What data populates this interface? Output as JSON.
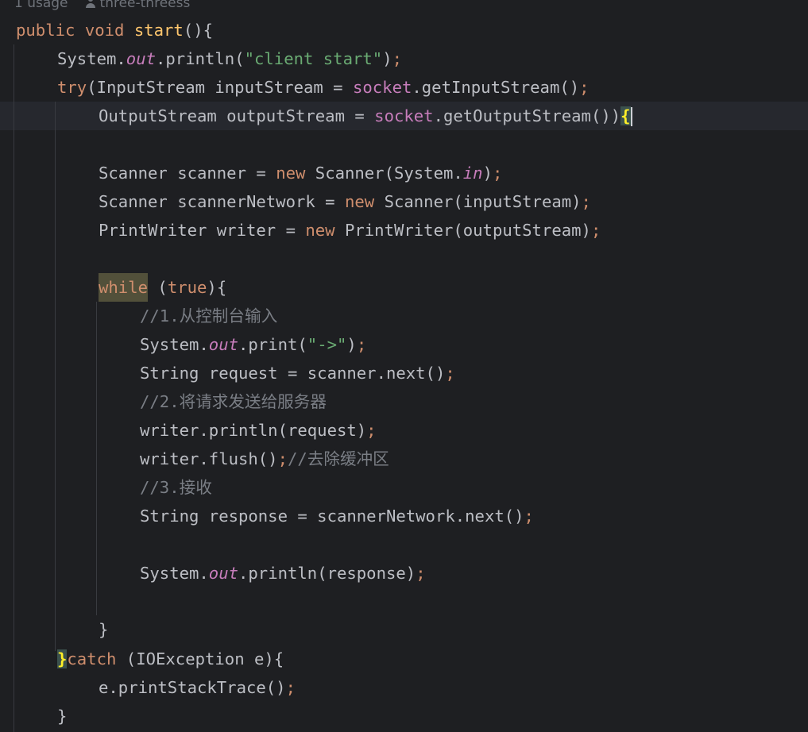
{
  "hint": {
    "usages": "1 usage",
    "author": "three-threess"
  },
  "code": {
    "l01_kw1": "public",
    "l01_kw2": "void",
    "l01_fn": "start",
    "l01_rest": "(){",
    "l02_a": "System.",
    "l02_out": "out",
    "l02_b": ".println(",
    "l02_str": "\"client start\"",
    "l02_c": ")",
    "l02_semi": ";",
    "l03_try": "try",
    "l03_a": "(InputStream inputStream = ",
    "l03_sock": "socket",
    "l03_b": ".getInputStream()",
    "l03_semi": ";",
    "l04_a": "OutputStream outputStream = ",
    "l04_sock": "socket",
    "l04_b": ".getOutputStream())",
    "l04_brace": "{",
    "l06_a": "Scanner scanner = ",
    "l06_new": "new",
    "l06_b": " Scanner(System.",
    "l06_in": "in",
    "l06_c": ")",
    "l06_semi": ";",
    "l07_a": "Scanner scannerNetwork = ",
    "l07_new": "new",
    "l07_b": " Scanner(inputStream)",
    "l07_semi": ";",
    "l08_a": "PrintWriter writer = ",
    "l08_new": "new",
    "l08_b": " PrintWriter(outputStream)",
    "l08_semi": ";",
    "l10_while": "while",
    "l10_a": " (",
    "l10_true": "true",
    "l10_b": "){",
    "l11_cmt": "//1.",
    "l11_cjk": "从控制台输入",
    "l12_a": "System.",
    "l12_out": "out",
    "l12_b": ".print(",
    "l12_str": "\"->\"",
    "l12_c": ")",
    "l12_semi": ";",
    "l13_a": "String request = scanner.next()",
    "l13_semi": ";",
    "l14_cmt": "//2.",
    "l14_cjk": "将请求发送给服务器",
    "l15_a": "writer.println(request)",
    "l15_semi": ";",
    "l16_a": "writer.flush()",
    "l16_semi": ";",
    "l16_cmt": "//",
    "l16_cjk": "去除缓冲区",
    "l17_cmt": "//3.",
    "l17_cjk": "接收",
    "l18_a": "String response = scannerNetwork.next()",
    "l18_semi": ";",
    "l20_a": "System.",
    "l20_out": "out",
    "l20_b": ".println(response)",
    "l20_semi": ";",
    "l22_brace": "}",
    "l23_brace": "}",
    "l23_catch": "catch",
    "l23_a": " (IOException e){",
    "l24_a": "e.printStackTrace()",
    "l24_semi": ";",
    "l25_brace": "}"
  },
  "colors": {
    "background": "#1e1f22",
    "keyword": "#cf8e6d",
    "string": "#6aab73",
    "field": "#c77dbb",
    "method_decl": "#ffc66d",
    "comment": "#7a7e85",
    "text": "#bcbec4"
  }
}
